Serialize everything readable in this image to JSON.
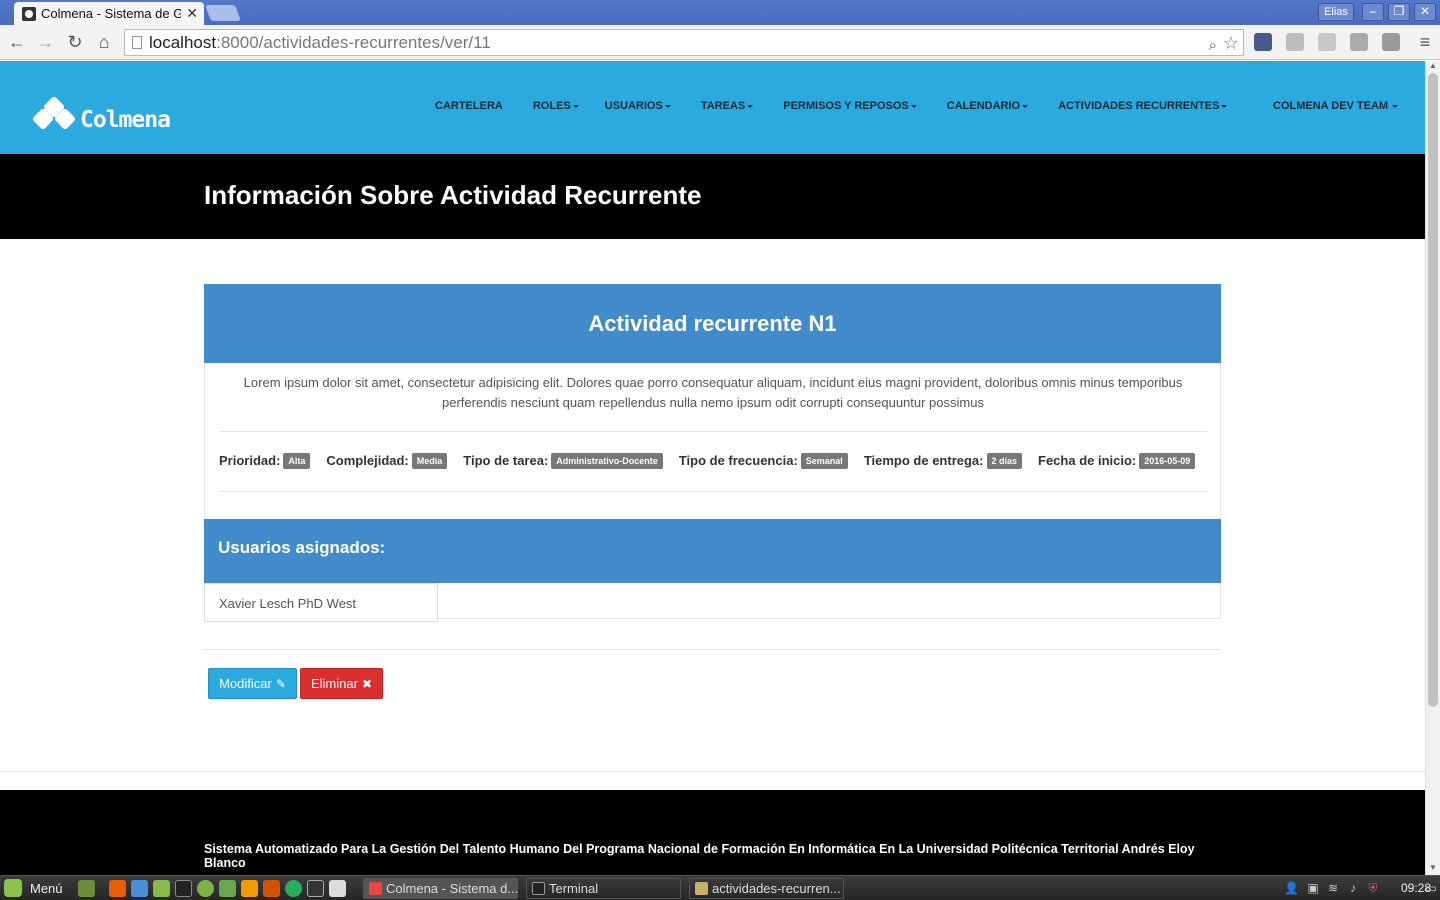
{
  "browser": {
    "tab_title": "Colmena - Sistema de Ge",
    "window_user": "Elias",
    "url_host": "localhost",
    "url_rest": ":8000/actividades-recurrentes/ver/11"
  },
  "site": {
    "logo_text": "Colmena",
    "menu": [
      {
        "label": "CARTELERA",
        "dropdown": false
      },
      {
        "label": "ROLES",
        "dropdown": true
      },
      {
        "label": "USUARIOS",
        "dropdown": true
      },
      {
        "label": "TAREAS",
        "dropdown": true
      },
      {
        "label": "PERMISOS Y REPOSOS",
        "dropdown": true
      },
      {
        "label": "CALENDARIO",
        "dropdown": true
      },
      {
        "label": "ACTIVIDADES RECURRENTES",
        "dropdown": true
      }
    ],
    "team_menu": "COLMENA DEV TEAM",
    "page_title": "Información Sobre Actividad Recurrente"
  },
  "activity": {
    "title": "Actividad recurrente N1",
    "description": "Lorem ipsum dolor sit amet, consectetur adipisicing elit. Dolores quae porro consequatur aliquam, incidunt eius magni provident, doloribus omnis minus temporibus perferendis nesciunt quam repellendus nulla nemo ipsum odit corrupti consequuntur possimus",
    "properties": [
      {
        "label": "Prioridad:",
        "value": "Alta"
      },
      {
        "label": "Complejidad:",
        "value": "Media"
      },
      {
        "label": "Tipo de tarea:",
        "value": "Administrativo-Docente"
      },
      {
        "label": "Tipo de frecuencia:",
        "value": "Semanal"
      },
      {
        "label": "Tiempo de entrega:",
        "value": "2 días"
      },
      {
        "label": "Fecha de inicio:",
        "value": "2016-05-09"
      }
    ],
    "users_heading": "Usuarios asignados:",
    "users": [
      "Xavier Lesch PhD West"
    ],
    "edit_label": "Modificar",
    "delete_label": "Eliminar"
  },
  "footer": {
    "text": "Sistema Automatizado Para La Gestión Del Talento Humano Del Programa Nacional de Formación En Informática En La Universidad Politécnica Territorial Andrés Eloy Blanco"
  },
  "taskbar": {
    "menu_label": "Menú",
    "tasks": [
      "Colmena - Sistema d...",
      "Terminal",
      "actividades-recurren..."
    ],
    "clock": "09:28"
  },
  "colors": {
    "nav_blue": "#2aaadf",
    "panel_blue": "#428bca",
    "danger_red": "#d9302f",
    "badge_gray": "#777777"
  }
}
